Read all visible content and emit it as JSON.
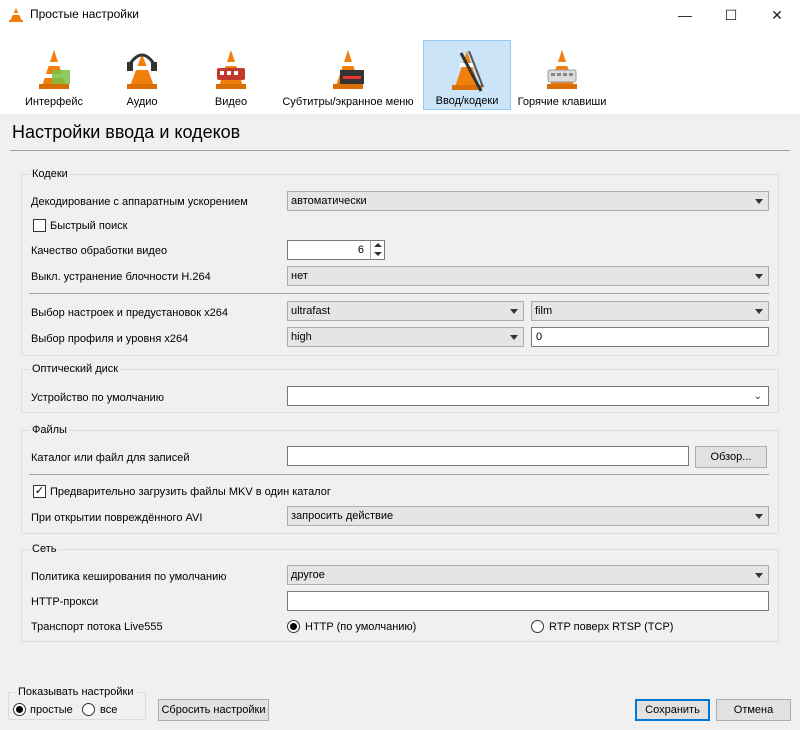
{
  "window": {
    "title": "Простые настройки",
    "minimize": "—",
    "maximize": "☐",
    "close": "✕"
  },
  "toolbar": [
    {
      "label": "Интерфейс",
      "icon": "interface-cone-icon"
    },
    {
      "label": "Аудио",
      "icon": "audio-cone-icon"
    },
    {
      "label": "Видео",
      "icon": "video-cone-icon"
    },
    {
      "label": "Субтитры/экранное меню",
      "icon": "subtitles-cone-icon"
    },
    {
      "label": "Ввод/кодеки",
      "icon": "input-codecs-cone-icon",
      "active": true
    },
    {
      "label": "Горячие клавиши",
      "icon": "hotkeys-cone-icon"
    }
  ],
  "page_title": "Настройки ввода и кодеков",
  "codecs": {
    "title": "Кодеки",
    "hw_decoding_label": "Декодирование с аппаратным ускорением",
    "hw_decoding_value": "автоматически",
    "fast_seek_label": "Быстрый поиск",
    "fast_seek_checked": false,
    "quality_label": "Качество обработки видео",
    "quality_value": "6",
    "deblock_label": "Выкл. устранение блочности H.264",
    "deblock_value": "нет",
    "x264_preset_label": "Выбор настроек и предустановок x264",
    "x264_preset_value": "ultrafast",
    "x264_tune_value": "film",
    "x264_profile_label": "Выбор профиля и уровня x264",
    "x264_profile_value": "high",
    "x264_level_value": "0"
  },
  "disc": {
    "title": "Оптический диск",
    "device_label": "Устройство по умолчанию",
    "device_value": ""
  },
  "files": {
    "title": "Файлы",
    "record_label": "Каталог или файл для записей",
    "record_value": "",
    "browse_label": "Обзор...",
    "mkv_label": "Предварительно загрузить файлы MKV в один каталог",
    "mkv_checked": true,
    "avi_label": "При открытии повреждённого AVI",
    "avi_value": "запросить действие"
  },
  "network": {
    "title": "Сеть",
    "caching_label": "Политика кеширования по умолчанию",
    "caching_value": "другое",
    "proxy_label": "HTTP-прокси",
    "proxy_value": "",
    "transport_label": "Транспорт потока Live555",
    "http_label": "HTTP (по умолчанию)",
    "rtp_label": "RTP поверх RTSP (TCP)",
    "selected": "http"
  },
  "show_settings": {
    "title": "Показывать настройки",
    "simple_label": "простые",
    "all_label": "все",
    "selected": "simple"
  },
  "buttons": {
    "reset": "Сбросить настройки",
    "save": "Сохранить",
    "cancel": "Отмена"
  },
  "colors": {
    "active_tab_bg": "#cce4f7",
    "active_tab_border": "#99c9ef",
    "default_button_border": "#0078d7",
    "cone_orange": "#f07f0b"
  }
}
